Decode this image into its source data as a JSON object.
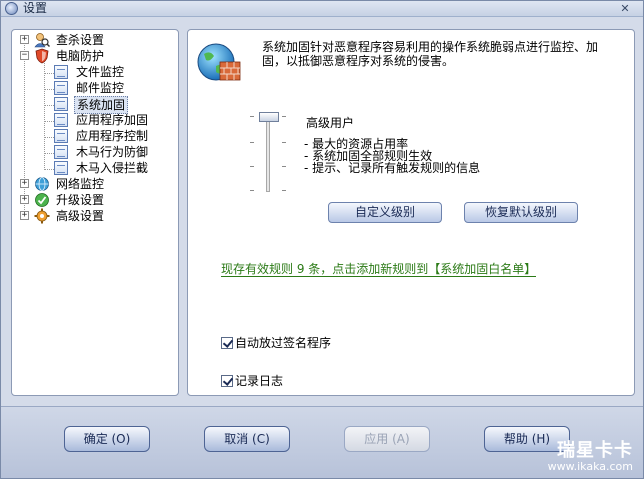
{
  "window": {
    "title": "设置",
    "close_glyph": "✕"
  },
  "tree": {
    "items": [
      {
        "label": "查杀设置",
        "toggle": "+",
        "icon": "search-person-icon"
      },
      {
        "label": "电脑防护",
        "toggle": "−",
        "icon": "shield-icon"
      },
      {
        "label": "文件监控",
        "icon": "document-icon"
      },
      {
        "label": "邮件监控",
        "icon": "document-icon"
      },
      {
        "label": "系统加固",
        "icon": "document-icon"
      },
      {
        "label": "应用程序加固",
        "icon": "document-icon"
      },
      {
        "label": "应用程序控制",
        "icon": "document-icon"
      },
      {
        "label": "木马行为防御",
        "icon": "document-icon"
      },
      {
        "label": "木马入侵拦截",
        "icon": "document-icon"
      },
      {
        "label": "网络监控",
        "toggle": "+",
        "icon": "network-icon"
      },
      {
        "label": "升级设置",
        "toggle": "+",
        "icon": "update-icon"
      },
      {
        "label": "高级设置",
        "toggle": "+",
        "icon": "gear-icon"
      }
    ]
  },
  "content": {
    "description": "系统加固针对恶意程序容易利用的操作系统脆弱点进行监控、加固，以抵御恶意程序对系统的侵害。",
    "level_name": "高级用户",
    "level_details": [
      "- 最大的资源占用率",
      "- 系统加固全部规则生效",
      "- 提示、记录所有触发规则的信息"
    ],
    "slider_level": 4,
    "slider_levels_total": 4,
    "custom_level_button": "自定义级别",
    "restore_default_button": "恢复默认级别",
    "rule_link": "现存有效规则 9 条，点击添加新规则到【系统加固白名单】",
    "checkbox_skip_signed": {
      "label": "自动放过签名程序",
      "checked": true
    },
    "checkbox_log": {
      "label": "记录日志",
      "checked": true
    }
  },
  "buttons": {
    "ok": "确定 (O)",
    "cancel": "取消 (C)",
    "apply": "应用 (A)",
    "help": "帮助 (H)"
  },
  "watermark": {
    "big": "瑞星卡卡",
    "small": "www.ikaka.com"
  }
}
